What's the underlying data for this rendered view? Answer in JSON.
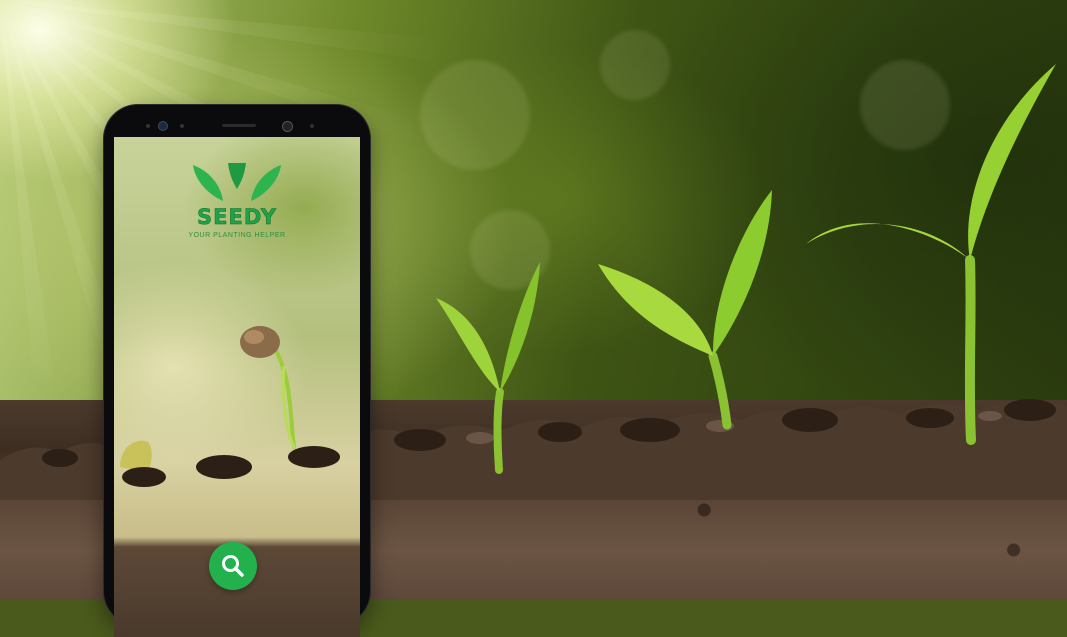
{
  "app": {
    "brand_name": "SEEDY",
    "tagline": "YOUR PLANTING HELPER",
    "brand_color": "#22b14c"
  },
  "actions": {
    "search_icon": "search-icon"
  },
  "scene": {
    "subject": "seedlings growing in soil, progressive growth stages",
    "seedling_count": 4
  }
}
